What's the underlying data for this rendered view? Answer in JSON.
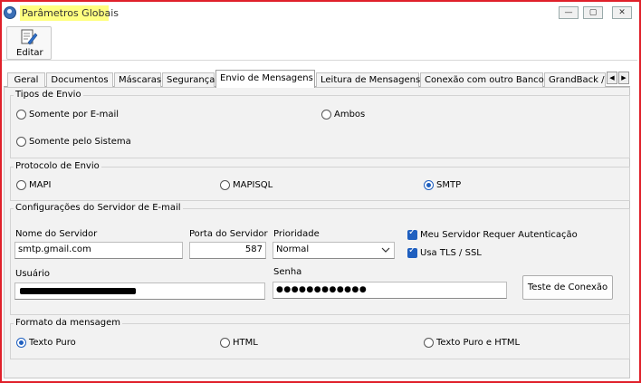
{
  "window": {
    "title": "Parâmetros Globais",
    "controls": {
      "minimize": "—",
      "maximize": "▢",
      "close": "✕"
    }
  },
  "toolbar": {
    "edit_label": "Editar"
  },
  "tabs": [
    "Geral",
    "Documentos",
    "Máscaras",
    "Segurança",
    "Envio de Mensagens",
    "Leitura de Mensagens",
    "Conexão com outro Banco",
    "GrandBack / I"
  ],
  "active_tab": "Envio de Mensagens",
  "tab_scroll": {
    "left": "◀",
    "right": "▶"
  },
  "tipos_envio": {
    "title": "Tipos de Envio",
    "options": [
      "Somente por E-mail",
      "Ambos",
      "Somente pelo Sistema"
    ],
    "selected": null
  },
  "protocolo": {
    "title": "Protocolo de Envio",
    "options": [
      "MAPI",
      "MAPISQL",
      "SMTP"
    ],
    "selected": "SMTP"
  },
  "servidor": {
    "title": "Configurações do Servidor de E-mail",
    "nome_label": "Nome do Servidor",
    "nome_value": "smtp.gmail.com",
    "porta_label": "Porta do Servidor",
    "porta_value": "587",
    "prioridade_label": "Prioridade",
    "prioridade_value": "Normal",
    "auth_label": "Meu Servidor Requer Autenticação",
    "auth_checked": true,
    "tls_label": "Usa TLS / SSL",
    "tls_checked": true,
    "usuario_label": "Usuário",
    "senha_label": "Senha",
    "senha_value": "●●●●●●●●●●●●",
    "teste_label": "Teste de Conexão"
  },
  "formato": {
    "title": "Formato da mensagem",
    "options": [
      "Texto Puro",
      "HTML",
      "Texto Puro e HTML"
    ],
    "selected": "Texto Puro"
  },
  "colors": {
    "accent": "#1f5fbf",
    "frame": "#e0202a",
    "title_highlight": "#ffff80"
  }
}
